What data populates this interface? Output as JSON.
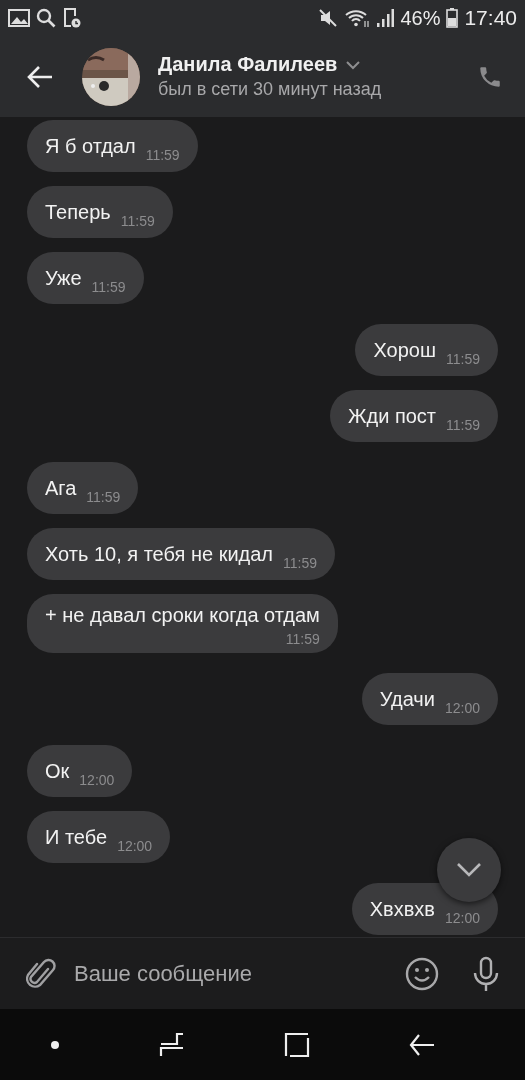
{
  "status_bar": {
    "battery": "46%",
    "time": "17:40"
  },
  "header": {
    "name": "Данила Фалилеев",
    "status": "был в сети 30 минут назад"
  },
  "messages": [
    {
      "text": "Я б отдал",
      "time": "11:59",
      "outgoing": false
    },
    {
      "text": "Теперь",
      "time": "11:59",
      "outgoing": false
    },
    {
      "text": "Уже",
      "time": "11:59",
      "outgoing": false
    },
    {
      "text": "Хорош",
      "time": "11:59",
      "outgoing": true
    },
    {
      "text": "Жди пост",
      "time": "11:59",
      "outgoing": true
    },
    {
      "text": "Ага",
      "time": "11:59",
      "outgoing": false
    },
    {
      "text": "Хоть 10, я тебя не кидал",
      "time": "11:59",
      "outgoing": false
    },
    {
      "text": "+ не давал сроки когда отдам",
      "time": "11:59",
      "outgoing": false,
      "kind": "wrapped"
    },
    {
      "text": "Удачи",
      "time": "12:00",
      "outgoing": true
    },
    {
      "text": "Ок",
      "time": "12:00",
      "outgoing": false
    },
    {
      "text": "И тебе",
      "time": "12:00",
      "outgoing": false
    },
    {
      "text": "Хвхвхв",
      "time": "12:00",
      "outgoing": true
    }
  ],
  "composer": {
    "placeholder": "Ваше сообщение"
  }
}
